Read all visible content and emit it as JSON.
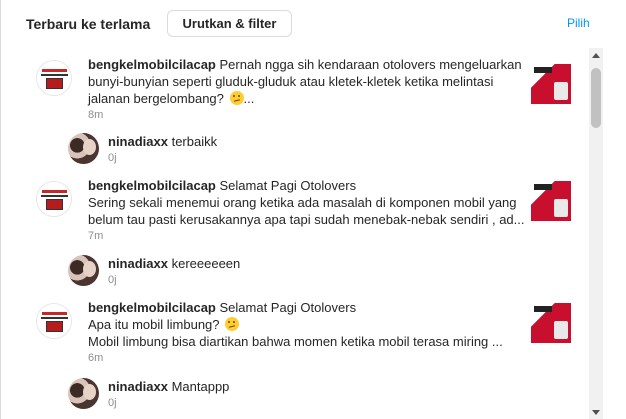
{
  "header": {
    "sort_title": "Terbaru ke terlama",
    "sort_button": "Urutkan & filter",
    "select_link": "Pilih"
  },
  "messages": [
    {
      "username": "bengkelmobilcilacap",
      "text_line1": "Pernah ngga sih kendaraan otolovers mengeluarkan",
      "text_line2": "bunyi-bunyian seperti gluduk-gluduk atau kletek-kletek ketika melintasi",
      "text_line3": "jalanan bergelombang?",
      "text_line3_suffix": "...",
      "time": "8m",
      "emoji": "thinking-face"
    },
    {
      "username": "ninadiaxx",
      "text": "terbaikk",
      "time": "0j"
    },
    {
      "username": "bengkelmobilcilacap",
      "text_line1": "Selamat Pagi Otolovers",
      "text_line2": "Sering sekali menemui orang ketika ada masalah di komponen mobil yang",
      "text_line3": "belum tau pasti kerusakannya apa tapi sudah menebak-nebak sendiri , ad...",
      "time": "7m"
    },
    {
      "username": "ninadiaxx",
      "text": "kereeeeeen",
      "time": "0j"
    },
    {
      "username": "bengkelmobilcilacap",
      "text_line1": "Selamat Pagi Otolovers",
      "text_line2": "Apa itu mobil limbung?",
      "text_line3": "Mobil limbung bisa diartikan bahwa momen ketika mobil terasa miring ...",
      "time": "6m",
      "emoji": "thinking-face"
    },
    {
      "username": "ninadiaxx",
      "text": "Mantappp",
      "time": "0j"
    }
  ],
  "colors": {
    "accent": "#0095f6",
    "muted": "#8e8e8e",
    "thumbnail_red": "#c8102e"
  }
}
